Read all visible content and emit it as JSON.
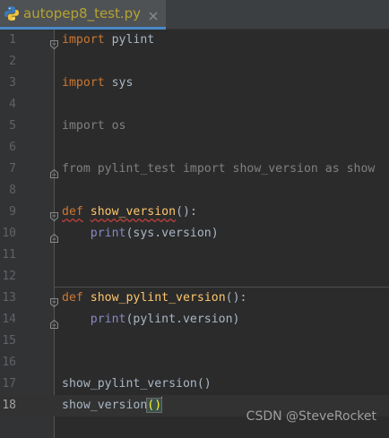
{
  "tab": {
    "filename": "autopep8_test.py",
    "icon": "python-file-icon"
  },
  "editor": {
    "current_line": 18,
    "lines": [
      {
        "num": "1"
      },
      {
        "num": "2"
      },
      {
        "num": "3"
      },
      {
        "num": "4"
      },
      {
        "num": "5"
      },
      {
        "num": "6"
      },
      {
        "num": "7"
      },
      {
        "num": "8"
      },
      {
        "num": "9"
      },
      {
        "num": "10"
      },
      {
        "num": "11"
      },
      {
        "num": "12"
      },
      {
        "num": "13"
      },
      {
        "num": "14"
      },
      {
        "num": "15"
      },
      {
        "num": "16"
      },
      {
        "num": "17"
      },
      {
        "num": "18"
      }
    ],
    "code": {
      "l1_kw": "import",
      "l1_rest": " pylint",
      "l3_kw": "import",
      "l3_rest": " sys",
      "l5": "import os",
      "l7": "from pylint_test import show_version as show",
      "l9_kw": "def",
      "l9_fn": "show_version",
      "l9_rest": "():",
      "l10_indent": "    ",
      "l10_builtin": "print",
      "l10_rest": "(sys.version)",
      "l13_kw": "def",
      "l13_fn": "show_pylint_version",
      "l13_rest": "():",
      "l14_indent": "    ",
      "l14_builtin": "print",
      "l14_rest": "(pylint.version)",
      "l17": "show_pylint_version()",
      "l18_name": "show_version",
      "l18_paren": "()"
    }
  },
  "watermark": "CSDN @SteveRocket",
  "colors": {
    "background": "#2b2b2b",
    "gutter": "#313335",
    "keyword": "#cc7832",
    "function": "#ffc66d",
    "builtin": "#8888c6",
    "text": "#a9b7c6",
    "unused_import": "#808080",
    "tab_filename": "#b6a232"
  }
}
